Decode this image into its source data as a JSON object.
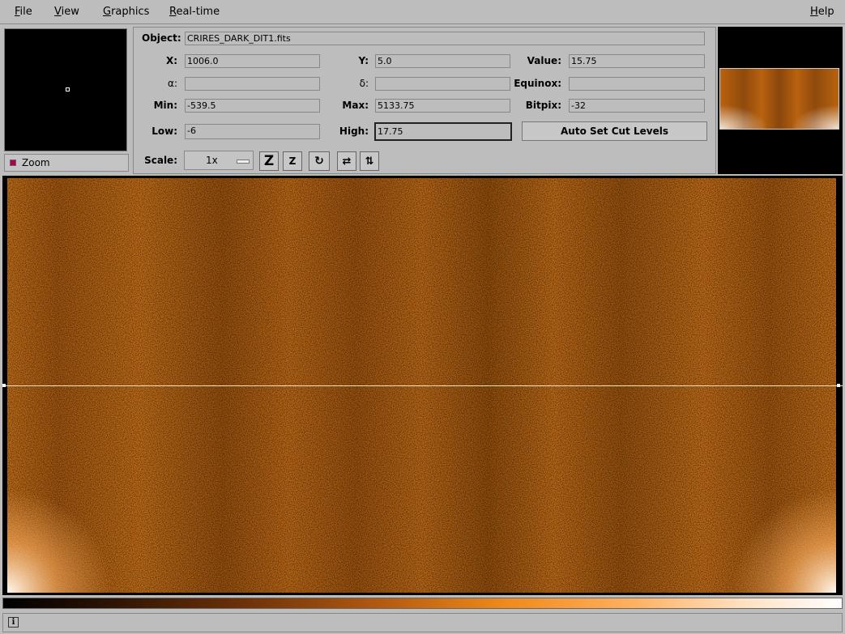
{
  "menubar": {
    "file": {
      "first": "F",
      "rest": "ile"
    },
    "view": {
      "first": "V",
      "rest": "iew"
    },
    "graphics": {
      "first": "G",
      "rest": "raphics"
    },
    "realtime": {
      "first": "R",
      "rest": "eal-time"
    },
    "help": {
      "first": "H",
      "rest": "elp"
    }
  },
  "zoom": {
    "toggle_label": "Zoom"
  },
  "info": {
    "object_label": "Object:",
    "object_value": "CRIRES_DARK_DIT1.fits",
    "x_label": "X:",
    "x_value": "1006.0",
    "y_label": "Y:",
    "y_value": "5.0",
    "value_label": "Value:",
    "value_value": "15.75",
    "alpha_label": "α:",
    "alpha_value": "",
    "delta_label": "δ:",
    "delta_value": "",
    "equinox_label": "Equinox:",
    "equinox_value": "",
    "min_label": "Min:",
    "min_value": "-539.5",
    "max_label": "Max:",
    "max_value": "5133.75",
    "bitpix_label": "Bitpix:",
    "bitpix_value": "-32",
    "low_label": "Low:",
    "low_value": "-6",
    "high_label": "High:",
    "high_value": "17.75",
    "auto_cut_label": "Auto Set Cut Levels",
    "scale_label": "Scale:",
    "scale_value": "1x"
  },
  "toolbar_icons": [
    "zoom-in-icon",
    "zoom-out-icon",
    "rotate-icon",
    "flip-x-icon",
    "flip-y-icon"
  ],
  "colors": {
    "image_base": "#bf6a18",
    "background": "#bdbdbd"
  },
  "status": {
    "icon": "info-icon",
    "text": ""
  }
}
